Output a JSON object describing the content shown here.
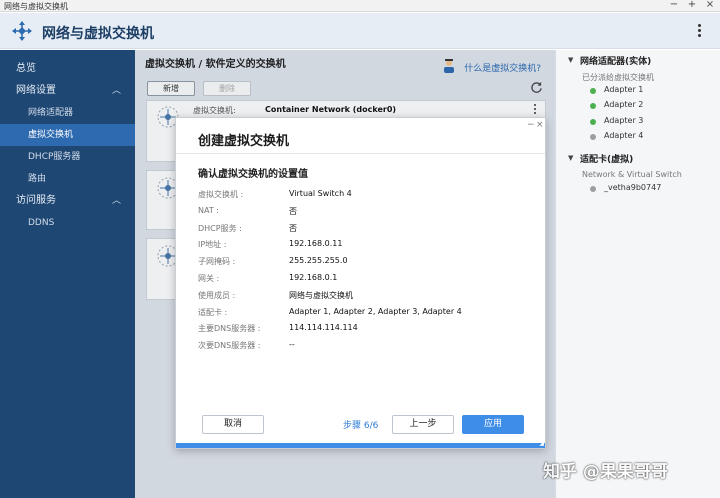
{
  "os": {
    "title": "网络与虚拟交换机"
  },
  "app": {
    "title": "网络与虚拟交换机"
  },
  "sidebar": {
    "items": [
      {
        "label": "总览"
      },
      {
        "label": "网络设置"
      },
      {
        "label": "网络适配器"
      },
      {
        "label": "虚拟交换机"
      },
      {
        "label": "DHCP服务器"
      },
      {
        "label": "路由"
      },
      {
        "label": "访问服务"
      },
      {
        "label": "DDNS"
      }
    ]
  },
  "main": {
    "breadcrumb": "虚拟交换机 / 软件定义的交换机",
    "help_link": "什么是虚拟交换机?",
    "add_label": "新增",
    "delete_label": "删除",
    "cards": [
      {
        "label": "虚拟交换机:",
        "value": "Container Network (docker0)"
      }
    ]
  },
  "right_panel": {
    "section1_title": "网络适配器(实体)",
    "section1_sub": "已分派给虚拟交换机",
    "adapters": [
      "Adapter 1",
      "Adapter 2",
      "Adapter 3",
      "Adapter 4"
    ],
    "adapter_colors": [
      "#4caf50",
      "#4caf50",
      "#4caf50",
      "#9e9e9e"
    ],
    "section2_title": "适配卡(虚拟)",
    "section2_sub": "Network & Virtual Switch",
    "virtual_items": [
      "_vetha9b0747"
    ]
  },
  "modal": {
    "title": "创建虚拟交换机",
    "subtitle": "确认虚拟交换机的设置值",
    "rows": [
      {
        "label": "虚拟交换机 :",
        "value": "Virtual Switch 4"
      },
      {
        "label": "NAT :",
        "value": "否"
      },
      {
        "label": "DHCP服务 :",
        "value": "否"
      },
      {
        "label": "IP地址 :",
        "value": "192.168.0.11"
      },
      {
        "label": "子网掩码 :",
        "value": "255.255.255.0"
      },
      {
        "label": "网关 :",
        "value": "192.168.0.1"
      },
      {
        "label": "使用成员 :",
        "value": "网络与虚拟交换机"
      },
      {
        "label": "适配卡 :",
        "value": "Adapter 1, Adapter 2, Adapter 3, Adapter 4"
      },
      {
        "label": "主要DNS服务器 :",
        "value": "114.114.114.114"
      },
      {
        "label": "次要DNS服务器 :",
        "value": "--"
      }
    ],
    "cancel_label": "取消",
    "step_label": "步骤 6/6",
    "prev_label": "上一步",
    "apply_label": "应用"
  },
  "watermark": "知乎 @果果哥哥",
  "colors": {
    "sidebar": "#1f4773",
    "sidebar_active": "#2d6ab0",
    "accent": "#3e8de6"
  }
}
